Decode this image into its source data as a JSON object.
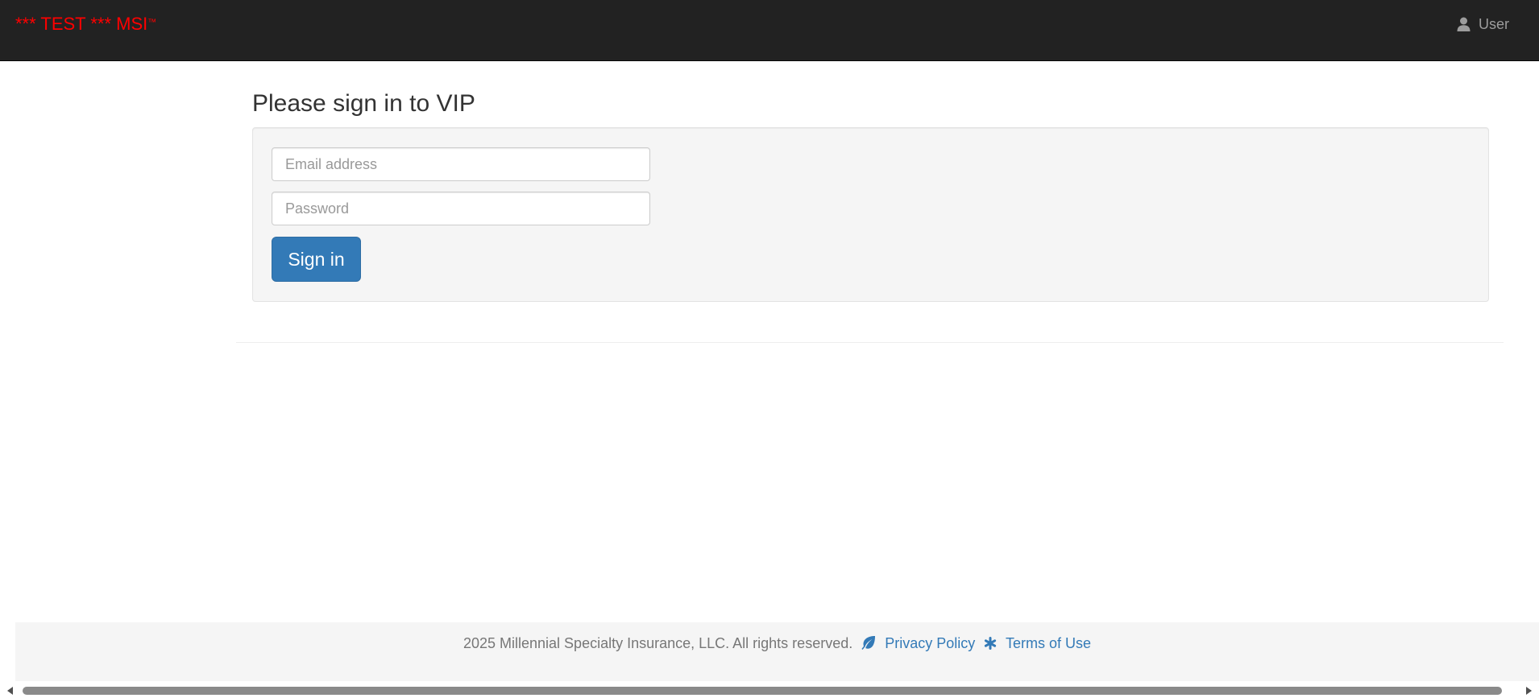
{
  "navbar": {
    "brand": "*** TEST *** MSI",
    "brand_tm": "™",
    "user_icon": "user-icon",
    "user_label": "User"
  },
  "main": {
    "title": "Please sign in to VIP",
    "email_placeholder": "Email address",
    "password_placeholder": "Password",
    "signin_label": "Sign in"
  },
  "footer": {
    "copyright": "2025 Millennial Specialty Insurance, LLC. All rights reserved.",
    "leaf_icon": "leaf-icon",
    "privacy_label": "Privacy Policy",
    "asterisk_icon": "asterisk-icon",
    "terms_label": "Terms of Use"
  },
  "colors": {
    "navbar_bg": "#222222",
    "brand": "#ff0000",
    "primary": "#337ab7",
    "well_bg": "#f5f5f5",
    "footer_text": "#777777"
  }
}
